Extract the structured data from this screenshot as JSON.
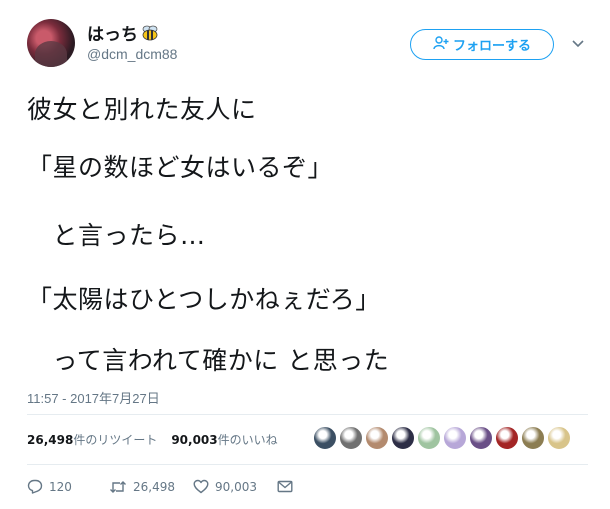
{
  "user": {
    "display_name": "はっち",
    "emoji_icon": "bee-icon",
    "handle": "@dcm_dcm88"
  },
  "follow_button": {
    "label": "フォローする",
    "icon": "add-user-icon"
  },
  "menu_icon": "chevron-down-icon",
  "tweet": {
    "lines": [
      "彼女と別れた友人に",
      "「星の数ほど女はいるぞ」",
      "　と言ったら…",
      "「太陽はひとつしかねぇだろ」",
      "　って言われて確かに と思った"
    ],
    "timestamp": "11:57 - 2017年7月27日"
  },
  "stats": {
    "retweets_count": "26,498",
    "retweets_label": "件のリツイート",
    "likes_count": "90,003",
    "likes_label": "件のいいね"
  },
  "likers": {
    "colors": [
      "#3b4f63",
      "#707070",
      "#b38a6e",
      "#2d2e46",
      "#9fc4a0",
      "#b7a7d8",
      "#6a4f87",
      "#a32525",
      "#8c7d52",
      "#d8c48a"
    ]
  },
  "actions": {
    "reply_count": "120",
    "retweet_count": "26,498",
    "like_count": "90,003"
  },
  "colors": {
    "accent": "#1da1f2",
    "secondary_text": "#657786",
    "divider": "#e6ecf0"
  }
}
